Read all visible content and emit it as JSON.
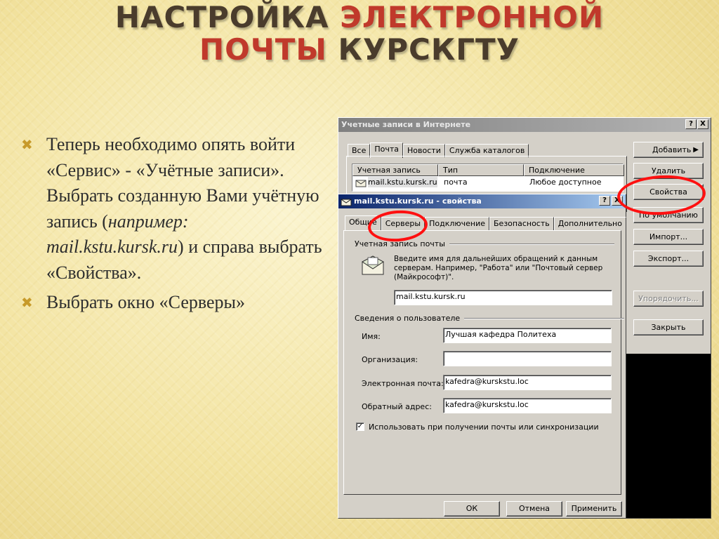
{
  "slide": {
    "title_part1": "НАСТРОЙКА ",
    "title_part2": "ЭЛЕКТРОННОЙ",
    "title_part3": "ПОЧТЫ",
    "title_part4": " КУРСКГТУ",
    "bullet1_a": "Теперь необходимо опять войти «Сервис» - «Учётные записи». Выбрать созданную Вами учётную запись (",
    "bullet1_italic": "например: mail.kstu.kursk.ru",
    "bullet1_b": ") и справа выбрать «Свойства».",
    "bullet2": "Выбрать окно «Серверы»",
    "bullet_marker": "✖"
  },
  "accounts_dialog": {
    "title": "Учетные записи в Интернете",
    "help_btn": "?",
    "close_btn": "X",
    "tabs": [
      "Все",
      "Почта",
      "Новости",
      "Служба каталогов"
    ],
    "columns": [
      "Учетная запись",
      "Тип",
      "Подключение"
    ],
    "row": {
      "account": "mail.kstu.kursk.ru",
      "type": "почта",
      "connection": "Любое доступное"
    },
    "buttons": {
      "add": "Добавить",
      "add_arrow": "▶",
      "delete": "Удалить",
      "properties": "Свойства",
      "default": "По умолчанию",
      "import": "Импорт...",
      "export": "Экспорт...",
      "order": "Упорядочить...",
      "close": "Закрыть"
    }
  },
  "properties_dialog": {
    "title": "mail.kstu.kursk.ru - свойства",
    "help_btn": "?",
    "close_btn": "X",
    "tabs": [
      "Общие",
      "Серверы",
      "Подключение",
      "Безопасность",
      "Дополнительно"
    ],
    "group_account": "Учетная запись почты",
    "account_hint": "Введите имя для дальнейших обращений к данным серверам. Например, \"Работа\" или \"Почтовый сервер (Майкрософт)\".",
    "account_name": "mail.kstu.kursk.ru",
    "group_user": "Сведения о пользователе",
    "labels": {
      "name": "Имя:",
      "organization": "Организация:",
      "email": "Электронная почта:",
      "reply": "Обратный адрес:"
    },
    "values": {
      "name": "Лучшая кафедра Политеха",
      "organization": "",
      "email": "kafedra@kurskstu.loc",
      "reply": "kafedra@kurskstu.loc"
    },
    "checkbox_label": "Использовать при получении почты или синхронизации",
    "checkbox_mark": "✓",
    "ok": "ОК",
    "cancel": "Отмена",
    "apply": "Применить"
  },
  "colors": {
    "accent_red": "#c0392b",
    "highlight_ring": "#ff1010",
    "title_dark": "#4a3c2c"
  }
}
